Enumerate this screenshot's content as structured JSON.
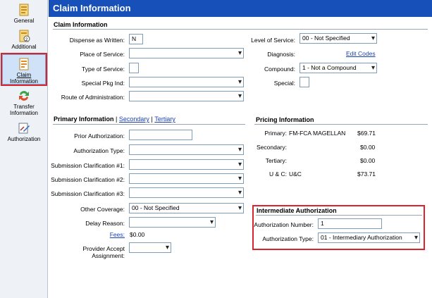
{
  "sidebar": {
    "items": [
      {
        "label": "General",
        "icon": "general-icon"
      },
      {
        "label": "Additional",
        "icon": "additional-icon"
      },
      {
        "label_l1": "Claim",
        "label_l2": "Information",
        "icon": "claim-info-icon"
      },
      {
        "label_l1": "Transfer",
        "label_l2": "Information",
        "icon": "transfer-icon"
      },
      {
        "label": "Authorization",
        "icon": "authorization-icon"
      }
    ]
  },
  "title": "Claim Information",
  "claim": {
    "header": "Claim Information",
    "dispense_label": "Dispense as Written:",
    "dispense_value": "N",
    "place_label": "Place of Service:",
    "place_value": "",
    "type_label": "Type of Service:",
    "type_value": "",
    "pkg_label": "Special Pkg Ind:",
    "pkg_value": "",
    "route_label": "Route of Administration:",
    "route_value": "",
    "level_label": "Level of Service:",
    "level_value": "00 - Not Specified",
    "diag_label": "Diagnosis:",
    "diag_link": "Edit Codes",
    "compound_label": "Compound:",
    "compound_value": "1 - Not a Compound",
    "special_label": "Special:",
    "special_value": ""
  },
  "primary": {
    "tab_primary": "Primary Information",
    "tab_sep": "|",
    "tab_secondary": "Secondary",
    "tab_tertiary": "Tertiary",
    "prior_label": "Prior Authorization:",
    "prior_value": "",
    "authtype_label": "Authorization Type:",
    "authtype_value": "",
    "sc1_label": "Submission Clarification #1:",
    "sc2_label": "Submission Clarification #2:",
    "sc3_label": "Submission Clarification #3:",
    "sc_value": "",
    "other_label": "Other Coverage:",
    "other_value": "00 - Not Specified",
    "delay_label": "Delay Reason:",
    "delay_value": "",
    "fees_link": "Fees:",
    "fees_value": "$0.00",
    "accept_label": "Provider Accept Assignment:",
    "accept_value": ""
  },
  "pricing": {
    "header": "Pricing Information",
    "primary_label": "Primary:",
    "primary_name": "FM-FCA MAGELLAN",
    "primary_amount": "$69.71",
    "secondary_label": "Secondary:",
    "secondary_amount": "$0.00",
    "tertiary_label": "Tertiary:",
    "tertiary_amount": "$0.00",
    "uc_label": "U & C:",
    "uc_name": "U&C",
    "uc_amount": "$73.71"
  },
  "intermediate": {
    "header": "Intermediate Authorization",
    "number_label": "Authorization Number:",
    "number_value": "1",
    "type_label": "Authorization Type:",
    "type_value": "01 - Intermediary Authorization"
  },
  "colors": {
    "title_bar": "#1750b8",
    "highlight": "#d9242b",
    "link": "#1a3fb8"
  }
}
